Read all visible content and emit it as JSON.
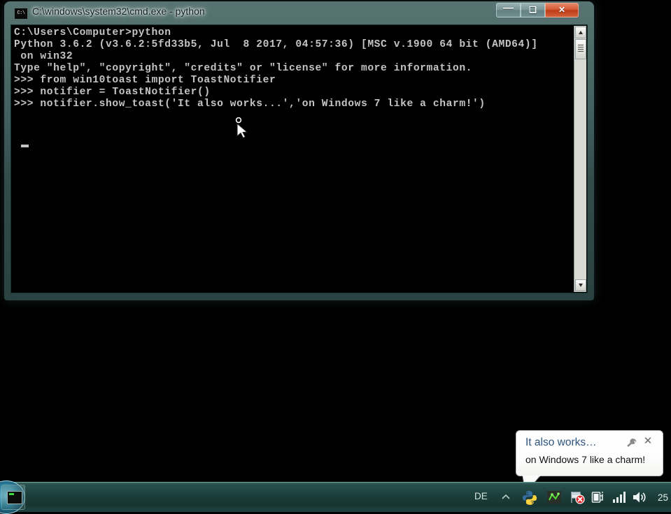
{
  "window": {
    "title": "C:\\windows\\system32\\cmd.exe - python",
    "icon_name": "cmd-icon",
    "icon_label": "C:\\",
    "controls": {
      "minimize_glyph": "—",
      "maximize_glyph": "❑",
      "close_glyph": "✕"
    },
    "console_text": "C:\\Users\\Computer>python\nPython 3.6.2 (v3.6.2:5fd33b5, Jul  8 2017, 04:57:36) [MSC v.1900 64 bit (AMD64)]\n on win32\nType \"help\", \"copyright\", \"credits\" or \"license\" for more information.\n>>> from win10toast import ToastNotifier\n>>> notifier = ToastNotifier()\n>>> notifier.show_toast('It also works...','on Windows 7 like a charm!')",
    "console_lines": [
      "C:\\Users\\Computer>python",
      "Python 3.6.2 (v3.6.2:5fd33b5, Jul  8 2017, 04:57:36) [MSC v.1900 64 bit (AMD64)]",
      " on win32",
      "Type \"help\", \"copyright\", \"credits\" or \"license\" for more information.",
      ">>> from win10toast import ToastNotifier",
      ">>> notifier = ToastNotifier()",
      ">>> notifier.show_toast('It also works...','on Windows 7 like a charm!')"
    ]
  },
  "toast": {
    "title": "It also works…",
    "body": "on Windows 7 like a charm!",
    "close_glyph": "✕",
    "options_icon_name": "wrench-icon"
  },
  "taskbar": {
    "language": "DE",
    "clock": "25",
    "tray_icons": [
      "python-icon",
      "green-status-icon",
      "action-center-flag-icon",
      "power-plug-icon",
      "network-bars-icon",
      "volume-speaker-icon"
    ]
  },
  "colors": {
    "console_background": "#000000",
    "console_text": "#c4c4c4",
    "taskbar": "#1d403d",
    "toast_title": "#2e5480",
    "close_button": "#bb3c15",
    "window_frame": "#466463"
  }
}
